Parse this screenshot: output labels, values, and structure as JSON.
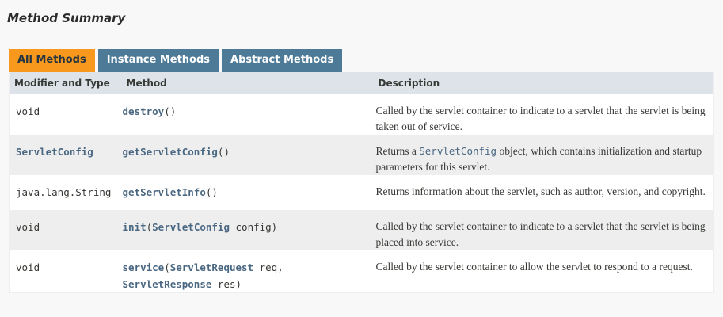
{
  "section": {
    "title": "Method Summary"
  },
  "tabs": [
    {
      "label": "All Methods",
      "active": true
    },
    {
      "label": "Instance Methods",
      "active": false
    },
    {
      "label": "Abstract Methods",
      "active": false
    }
  ],
  "columns": {
    "modifier": "Modifier and Type",
    "method": "Method",
    "description": "Description"
  },
  "rows": [
    {
      "type": "void",
      "type_is_link": false,
      "method_name": "destroy",
      "method_params": "()",
      "description": "Called by the servlet container to indicate to a servlet that the servlet is being taken out of service."
    },
    {
      "type": "ServletConfig",
      "type_is_link": true,
      "method_name": "getServletConfig",
      "method_params": "()",
      "description_before": "Returns a ",
      "description_code": "ServletConfig",
      "description_after": " object, which contains initialization and startup parameters for this servlet."
    },
    {
      "type": "java.lang.String",
      "type_is_link": false,
      "method_name": "getServletInfo",
      "method_params": "()",
      "description": "Returns information about the servlet, such as author, version, and copyright."
    },
    {
      "type": "void",
      "type_is_link": false,
      "method_name": "init",
      "param1_type": "ServletConfig",
      "param1_name": "config",
      "description": "Called by the servlet container to indicate to a servlet that the servlet is being placed into service."
    },
    {
      "type": "void",
      "type_is_link": false,
      "method_name": "service",
      "param1_type": "ServletRequest",
      "param1_name": "req",
      "param2_type": "ServletResponse",
      "param2_name": "res",
      "description": "Called by the servlet container to allow the servlet to respond to a request."
    }
  ],
  "colors": {
    "active_tab": "#f8981d",
    "inactive_tab": "#4d7a97",
    "header_bg": "#dee3e9",
    "link": "#4a6782",
    "row_alt": "#eeeeef"
  }
}
